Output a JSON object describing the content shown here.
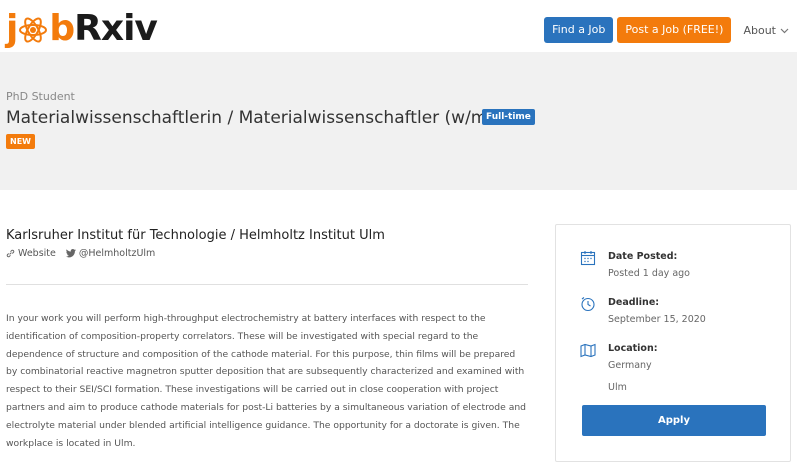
{
  "brand": {
    "logo_part1": "j",
    "logo_part2": "b",
    "logo_part3": "Rxiv",
    "accent": "#f37b0c",
    "primary": "#2a73bd"
  },
  "nav": {
    "find_job": "Find a Job",
    "post_job": "Post a Job (FREE!)",
    "about": "About"
  },
  "job": {
    "category": "PhD Student",
    "title": "Materialwissenschaftlerin / Materialwissenschaftler (w/m/d)",
    "type_badge": "Full-time",
    "new_badge": "NEW"
  },
  "company": {
    "name": "Karlsruher Institut für Technologie / Helmholtz Institut Ulm",
    "website_label": "Website",
    "twitter_handle": "@HelmholtzUlm"
  },
  "description": "In your work you will perform high-throughput electrochemistry at battery interfaces with respect to the identification of composition-property correlators. These will be investigated with special regard to the dependence of structure and composition of the cathode material. For this purpose, thin films will be prepared by combinatorial reactive magnetron sputter deposition that are subsequently characterized and examined with respect to their SEI/SCI formation. These investigations will be carried out in close cooperation with project partners and aim to produce cathode materials for post-Li batteries by a simultaneous variation of electrode and electrolyte material under blended artificial intelligence guidance. The opportunity for a doctorate is given. The workplace is located in Ulm.",
  "sidebar": {
    "date_posted_label": "Date Posted:",
    "date_posted_value": "Posted 1 day ago",
    "deadline_label": "Deadline:",
    "deadline_value": "September 15, 2020",
    "location_label": "Location:",
    "location_country": "Germany",
    "location_city": "Ulm",
    "apply_label": "Apply"
  }
}
